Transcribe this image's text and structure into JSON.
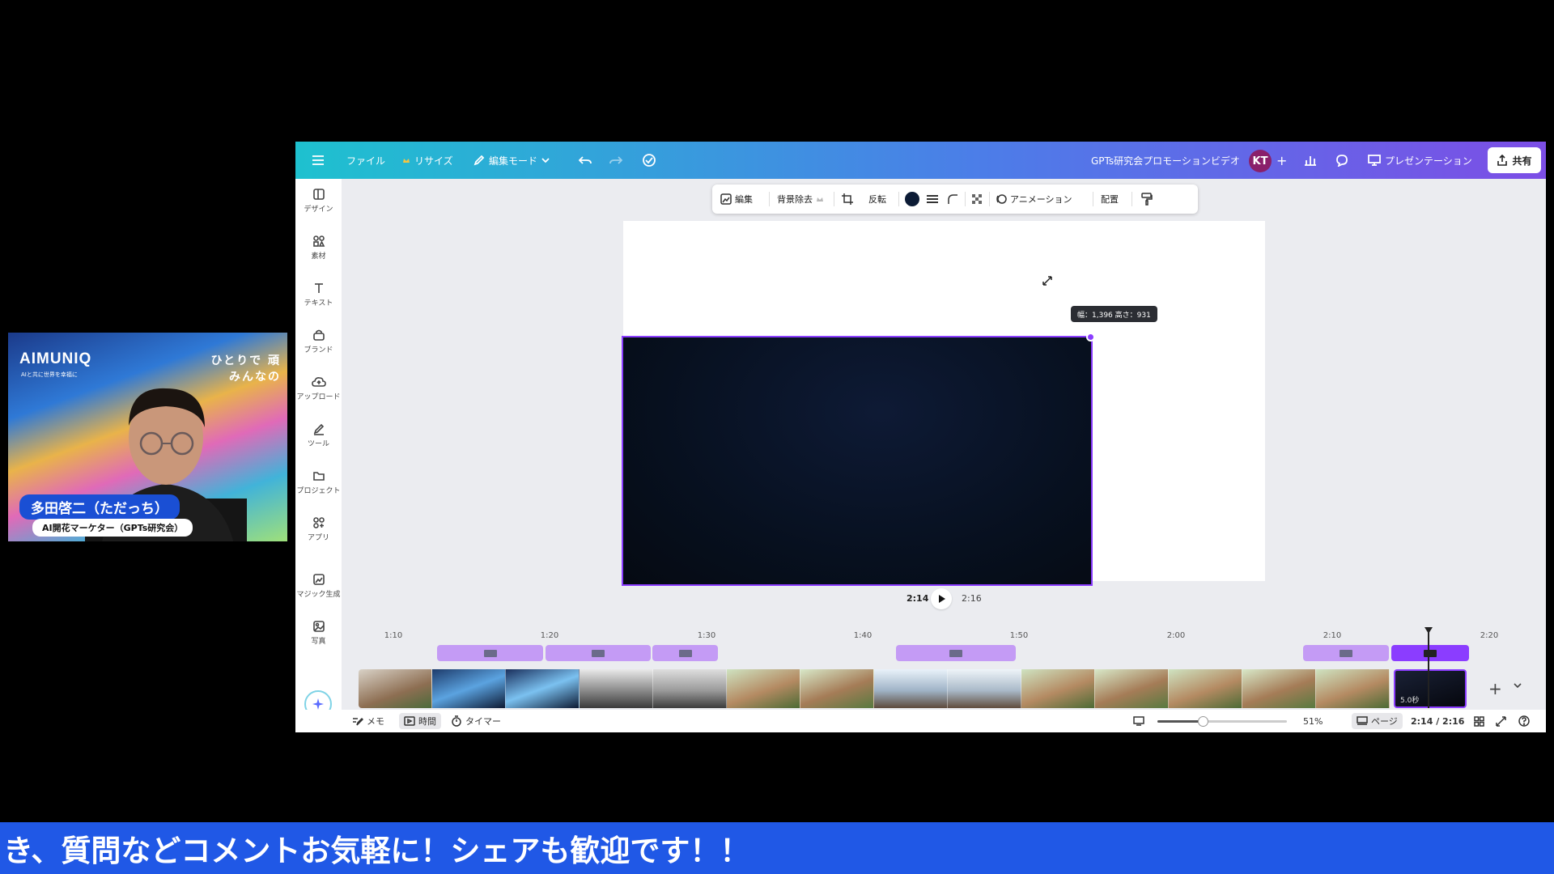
{
  "webcam": {
    "brand": "AIMUNIQ",
    "brand_sub": "AIと共に世界を幸福に",
    "slogan_line1": "ひとりで 頑",
    "slogan_line2": "みんなの",
    "speaker_name": "多田啓二（ただっち）",
    "speaker_title": "AI開花マーケター（GPTs研究会）"
  },
  "topbar": {
    "menu_file": "ファイル",
    "menu_resize": "リサイズ",
    "edit_mode": "編集モード",
    "project_title": "GPTs研究会プロモーションビデオ",
    "avatar_initials": "KT",
    "present_label": "プレゼンテーション",
    "share_label": "共有"
  },
  "sidebar": {
    "items": [
      {
        "label": "デザイン"
      },
      {
        "label": "素材"
      },
      {
        "label": "テキスト"
      },
      {
        "label": "ブランド"
      },
      {
        "label": "アップロード"
      },
      {
        "label": "ツール"
      },
      {
        "label": "プロジェクト"
      },
      {
        "label": "アプリ"
      },
      {
        "label": "マジック生成"
      },
      {
        "label": "写真"
      }
    ]
  },
  "context_toolbar": {
    "edit": "編集",
    "bg_remove": "背景除去",
    "flip": "反転",
    "animation": "アニメーション",
    "arrange": "配置"
  },
  "canvas": {
    "size_tooltip": "幅：1,396 高さ：931"
  },
  "playback": {
    "current": "2:14",
    "total": "2:16"
  },
  "timeline": {
    "ruler": [
      "1:10",
      "1:20",
      "1:30",
      "1:40",
      "1:50",
      "2:00",
      "2:10",
      "2:20"
    ],
    "last_clip_duration": "5.0秒"
  },
  "bottombar": {
    "notes": "メモ",
    "duration": "時間",
    "timer": "タイマー",
    "zoom": "51%",
    "zoom_fraction": 0.35,
    "pages": "ページ",
    "time_readout": "2:14 / 2:16"
  },
  "caption": {
    "text": "き、質問などコメントお気軽に！シェアも歓迎です！！"
  },
  "colors": {
    "accent": "#8b3dff",
    "topbar_start": "#1ec1cf",
    "topbar_end": "#7c4ee6",
    "caption_bg": "#2058e6",
    "audio_clip": "#c49bf5"
  }
}
